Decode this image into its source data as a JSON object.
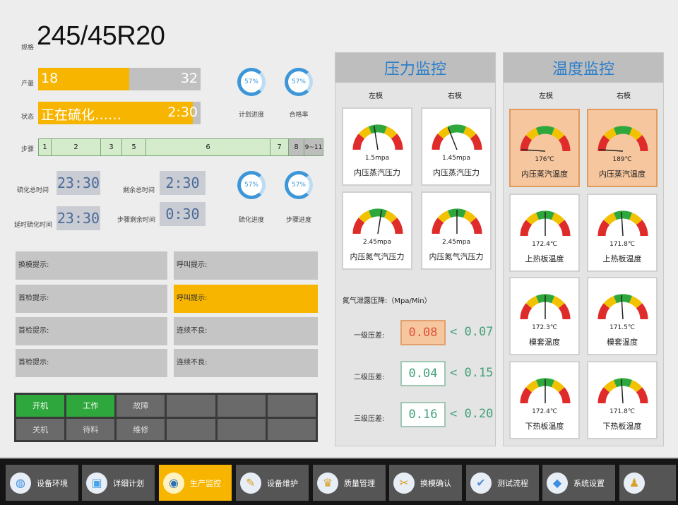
{
  "spec": {
    "label": "规格",
    "value": "245/45R20"
  },
  "output": {
    "label": "产量",
    "current": "18",
    "target": "32",
    "fraction": 0.5625
  },
  "state": {
    "label": "状态",
    "text": "正在硫化……",
    "time": "2:30",
    "fraction": 0.95
  },
  "steps": {
    "label": "步骤",
    "cells": [
      "1",
      "2",
      "3",
      "5",
      "6",
      "7",
      "8",
      "9~11"
    ]
  },
  "rings": [
    {
      "value": "57%",
      "label": "计划进度"
    },
    {
      "value": "57%",
      "label": "合格率"
    },
    {
      "value": "57%",
      "label": "硫化进度"
    },
    {
      "value": "57%",
      "label": "步骤进度"
    }
  ],
  "times": {
    "cure_total": {
      "label": "硫化总时间",
      "value": "23:30"
    },
    "remain_total": {
      "label": "剩余总时间",
      "value": "2:30"
    },
    "delay_cure": {
      "label": "延时硫化时间",
      "value": "23:30"
    },
    "step_remain": {
      "label": "步骤剩余时间",
      "value": "0:30"
    }
  },
  "tips": [
    {
      "text": "换模提示:"
    },
    {
      "text": "呼叫提示:"
    },
    {
      "text": "首检提示:"
    },
    {
      "text": "呼叫提示:"
    },
    {
      "text": "首检提示:"
    },
    {
      "text": "连续不良:"
    },
    {
      "text": "首检提示:"
    },
    {
      "text": "连续不良:"
    }
  ],
  "status_cells": [
    "开机",
    "工作",
    "故障",
    "",
    "",
    "",
    "关机",
    "待料",
    "维修",
    "",
    "",
    ""
  ],
  "pressure": {
    "title": "压力监控",
    "left": "左模",
    "right": "右模",
    "gauges": [
      {
        "value": "1.5mpa",
        "name": "内压蒸汽压力",
        "needle": 0.45
      },
      {
        "value": "1.45mpa",
        "name": "内压蒸汽压力",
        "needle": 0.38
      },
      {
        "value": "2.45mpa",
        "name": "内压氮气汽压力",
        "needle": 0.55
      },
      {
        "value": "2.45mpa",
        "name": "内压氮气汽压力",
        "needle": 0.5
      }
    ],
    "leak_title": "氮气泄露压降:（Mpa/Min）",
    "rows": [
      {
        "label": "一级压差:",
        "value": "0.08",
        "limit": "< 0.07",
        "alert": true
      },
      {
        "label": "二级压差:",
        "value": "0.04",
        "limit": "< 0.15",
        "alert": false
      },
      {
        "label": "三级压差:",
        "value": "0.16",
        "limit": "< 0.20",
        "alert": false
      }
    ]
  },
  "temperature": {
    "title": "温度监控",
    "left": "左模",
    "right": "右模",
    "gauges": [
      {
        "value": "176℃",
        "name": "内压蒸汽温度",
        "needle": 0.02,
        "hot": true
      },
      {
        "value": "189℃",
        "name": "内压蒸汽温度",
        "needle": 0.02,
        "hot": true
      },
      {
        "value": "172.4℃",
        "name": "上热板温度",
        "needle": 0.5,
        "hot": false
      },
      {
        "value": "171.8℃",
        "name": "上热板温度",
        "needle": 0.48,
        "hot": false
      },
      {
        "value": "172.3℃",
        "name": "模套温度",
        "needle": 0.5,
        "hot": false
      },
      {
        "value": "171.5℃",
        "name": "模套温度",
        "needle": 0.48,
        "hot": false
      },
      {
        "value": "172.4℃",
        "name": "下热板温度",
        "needle": 0.5,
        "hot": false
      },
      {
        "value": "171.8℃",
        "name": "下热板温度",
        "needle": 0.48,
        "hot": false
      }
    ]
  },
  "nav": [
    {
      "label": "设备环境",
      "icon": "globe-icon",
      "active": false
    },
    {
      "label": "详细计划",
      "icon": "camera-icon",
      "active": false
    },
    {
      "label": "生产监控",
      "icon": "monitor-icon",
      "active": true
    },
    {
      "label": "设备维护",
      "icon": "wrench-icon",
      "active": false
    },
    {
      "label": "质量管理",
      "icon": "trophy-icon",
      "active": false
    },
    {
      "label": "换模确认",
      "icon": "tool-icon",
      "active": false
    },
    {
      "label": "测试流程",
      "icon": "clipboard-icon",
      "active": false
    },
    {
      "label": "系统设置",
      "icon": "settings-icon",
      "active": false
    },
    {
      "label": "",
      "icon": "users-icon",
      "active": false
    }
  ],
  "colors": {
    "accent": "#f7b500",
    "blue": "#2e7fcb",
    "green": "#2ea83c",
    "alert": "#f6c69e"
  }
}
